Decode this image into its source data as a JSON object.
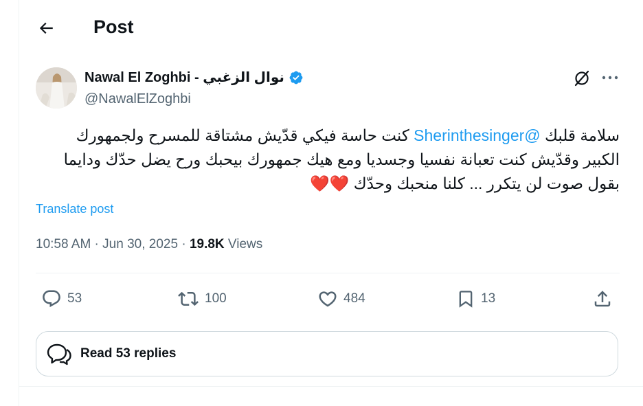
{
  "header": {
    "title": "Post"
  },
  "author": {
    "name": "Nawal El Zoghbi - نوال الزغبي",
    "handle": "@NawalElZoghbi",
    "verified": true,
    "verified_color": "#1d9bf0"
  },
  "post": {
    "text_before_mention": "سلامة قلبك ",
    "mention": "@Sherinthesinger",
    "text_after_mention": " كنت حاسة فيكي قدّيش مشتاقة للمسرح ولجمهورك الكبير وقدّيش كنت تعبانة نفسيا وجسديا ومع هيك جمهورك بيحبك ورح يضل حدّك ودايما بقول صوت لن يتكرر ... كلنا منحبك وحدّك ",
    "emoji": "❤️❤️",
    "translate_label": "Translate post"
  },
  "meta": {
    "time": "10:58 AM",
    "separator": " · ",
    "date": "Jun 30, 2025",
    "views_count": "19.8K",
    "views_label": " Views"
  },
  "actions": {
    "replies": "53",
    "reposts": "100",
    "likes": "484",
    "bookmarks": "13"
  },
  "read_replies": {
    "label": "Read 53 replies"
  },
  "colors": {
    "accent": "#1d9bf0",
    "muted": "#536471",
    "text": "#0f1419",
    "heart": "#e0245e"
  }
}
